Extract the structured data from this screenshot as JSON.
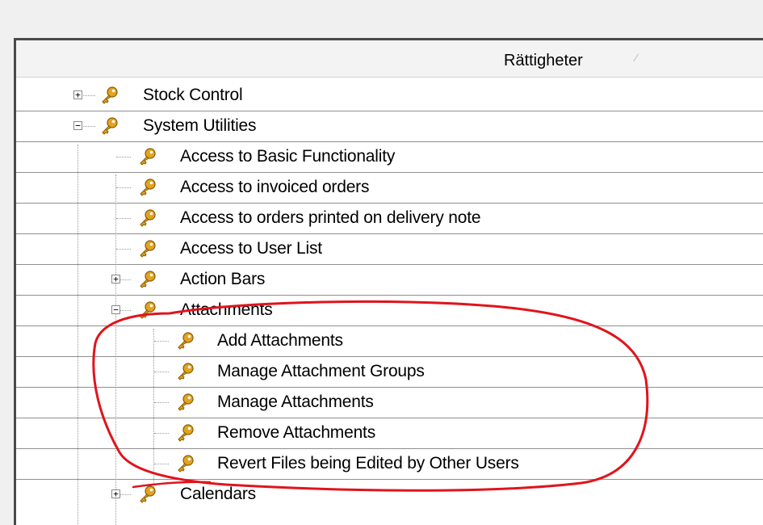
{
  "header": {
    "column_title": "Rättigheter",
    "sort_indicator": "⁄"
  },
  "tree": {
    "stock_control": "Stock Control",
    "system_utilities": "System Utilities",
    "access_basic": "Access to Basic Functionality",
    "access_invoiced": "Access to invoiced orders",
    "access_printed": "Access to orders printed on delivery note",
    "access_user_list": "Access to User List",
    "action_bars": "Action Bars",
    "attachments": "Attachments",
    "add_attachments": "Add Attachments",
    "manage_groups": "Manage Attachment Groups",
    "manage_attachments": "Manage Attachments",
    "remove_attachments": "Remove Attachments",
    "revert_files": "Revert Files being Edited by Other Users",
    "calendars": "Calendars"
  },
  "toggles": {
    "expand": "+",
    "collapse": "−"
  },
  "colors": {
    "key_gold": "#e2a420",
    "key_dark": "#8a5a00",
    "annotation_red": "#e0141c",
    "grid_line": "#8f8f8f"
  },
  "icons": {
    "node_icon": "key-icon"
  }
}
